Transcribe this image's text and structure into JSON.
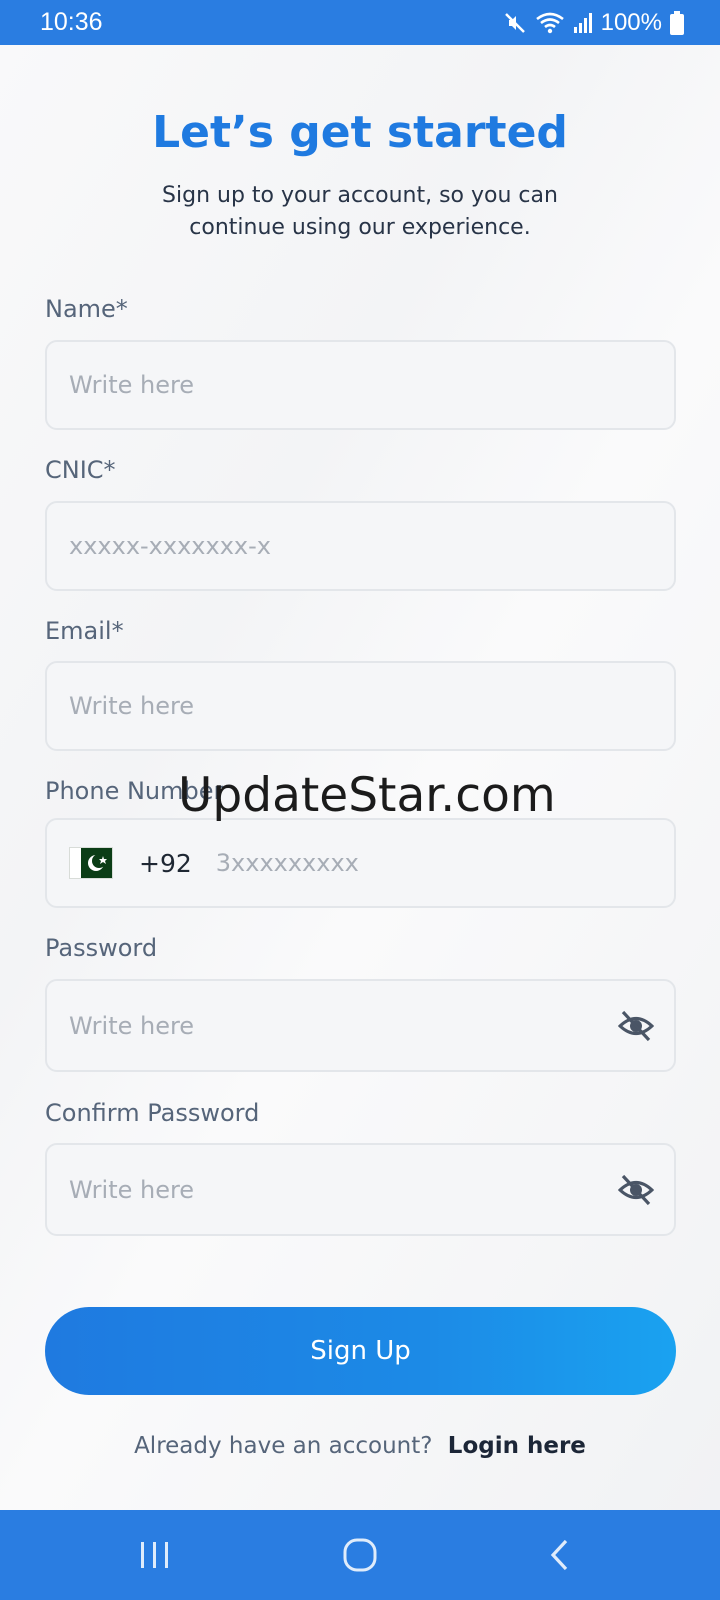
{
  "status_bar": {
    "time": "10:36",
    "battery": "100%",
    "icons": [
      "mute-icon",
      "wifi-icon",
      "signal-icon",
      "battery-icon"
    ]
  },
  "header": {
    "title": "Let’s get started",
    "subtitle": "Sign up to your account, so you can continue using our experience."
  },
  "form": {
    "name": {
      "label": "Name*",
      "placeholder": "Write here"
    },
    "cnic": {
      "label": "CNIC*",
      "placeholder": "xxxxx-xxxxxxx-x"
    },
    "email": {
      "label": "Email*",
      "placeholder": "Write here"
    },
    "phone": {
      "label": "Phone Number",
      "country_code": "+92",
      "placeholder": "3xxxxxxxxx",
      "flag": "pakistan-flag-icon"
    },
    "password": {
      "label": "Password",
      "placeholder": "Write here"
    },
    "confirm_password": {
      "label": "Confirm Password",
      "placeholder": "Write here"
    }
  },
  "actions": {
    "signup_label": "Sign Up",
    "login_prompt": "Already have an account?",
    "login_link": "Login here"
  },
  "watermark": "UpdateStar.com",
  "nav_bar": {
    "icons": [
      "recents-icon",
      "home-icon",
      "back-icon"
    ]
  },
  "colors": {
    "accent": "#1f7ae0",
    "system_bar": "#2a7de1"
  }
}
